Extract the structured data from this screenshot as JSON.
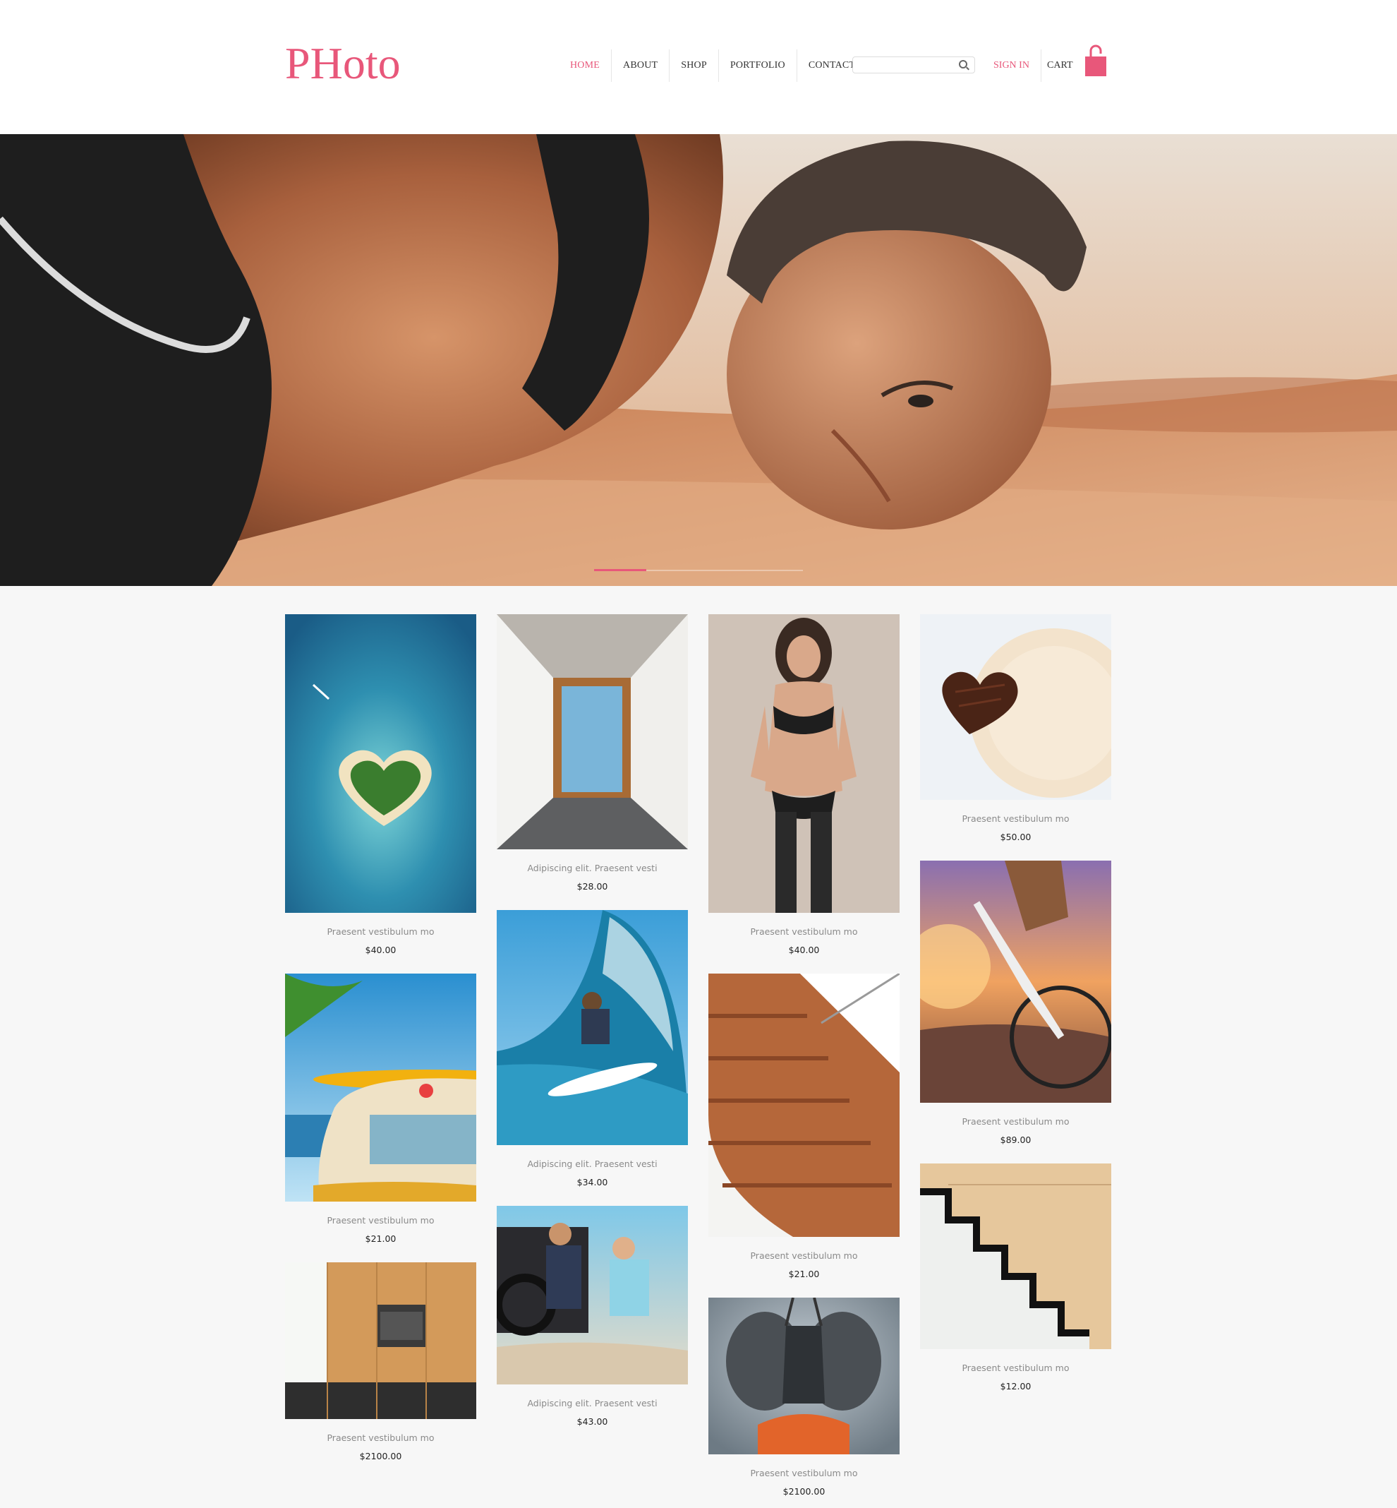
{
  "brand": {
    "logo": "PHoto",
    "accent_color": "#e8577a"
  },
  "nav": {
    "items": [
      {
        "label": "HOME",
        "active": true
      },
      {
        "label": "ABOUT",
        "active": false
      },
      {
        "label": "SHOP",
        "active": false
      },
      {
        "label": "PORTFOLIO",
        "active": false
      },
      {
        "label": "CONTACTS",
        "active": false
      }
    ],
    "signin_label": "SIGN IN",
    "cart_label": "CART"
  },
  "search": {
    "placeholder": ""
  },
  "hero": {
    "slide_index": 1,
    "slide_count": 4
  },
  "products": [
    {
      "caption": "Praesent vestibulum mo",
      "price": "$40.00",
      "photo": "heart-island-photo"
    },
    {
      "caption": "Praesent vestibulum mo",
      "price": "$21.00",
      "photo": "surfboard-van-photo"
    },
    {
      "caption": "Praesent vestibulum mo",
      "price": "$2100.00",
      "photo": "kitchen-photo"
    },
    {
      "caption": "Adipiscing elit. Praesent vesti",
      "price": "$28.00",
      "photo": "corridor-window-photo"
    },
    {
      "caption": "Adipiscing elit. Praesent vesti",
      "price": "$34.00",
      "photo": "surfer-wave-photo"
    },
    {
      "caption": "Adipiscing elit. Praesent vesti",
      "price": "$43.00",
      "photo": "motorbike-couple-photo"
    },
    {
      "caption": "Praesent vestibulum mo",
      "price": "$40.00",
      "photo": "model-lingerie-photo"
    },
    {
      "caption": "Praesent vestibulum mo",
      "price": "$21.00",
      "photo": "wooden-stairs-photo"
    },
    {
      "caption": "Praesent vestibulum mo",
      "price": "$2100.00",
      "photo": "insect-macro-photo"
    },
    {
      "caption": "Praesent vestibulum mo",
      "price": "$50.00",
      "photo": "chocolate-heart-coffee-photo"
    },
    {
      "caption": "Praesent vestibulum mo",
      "price": "$89.00",
      "photo": "mountain-bike-photo"
    },
    {
      "caption": "Praesent vestibulum mo",
      "price": "$12.00",
      "photo": "floating-stairs-photo"
    }
  ]
}
